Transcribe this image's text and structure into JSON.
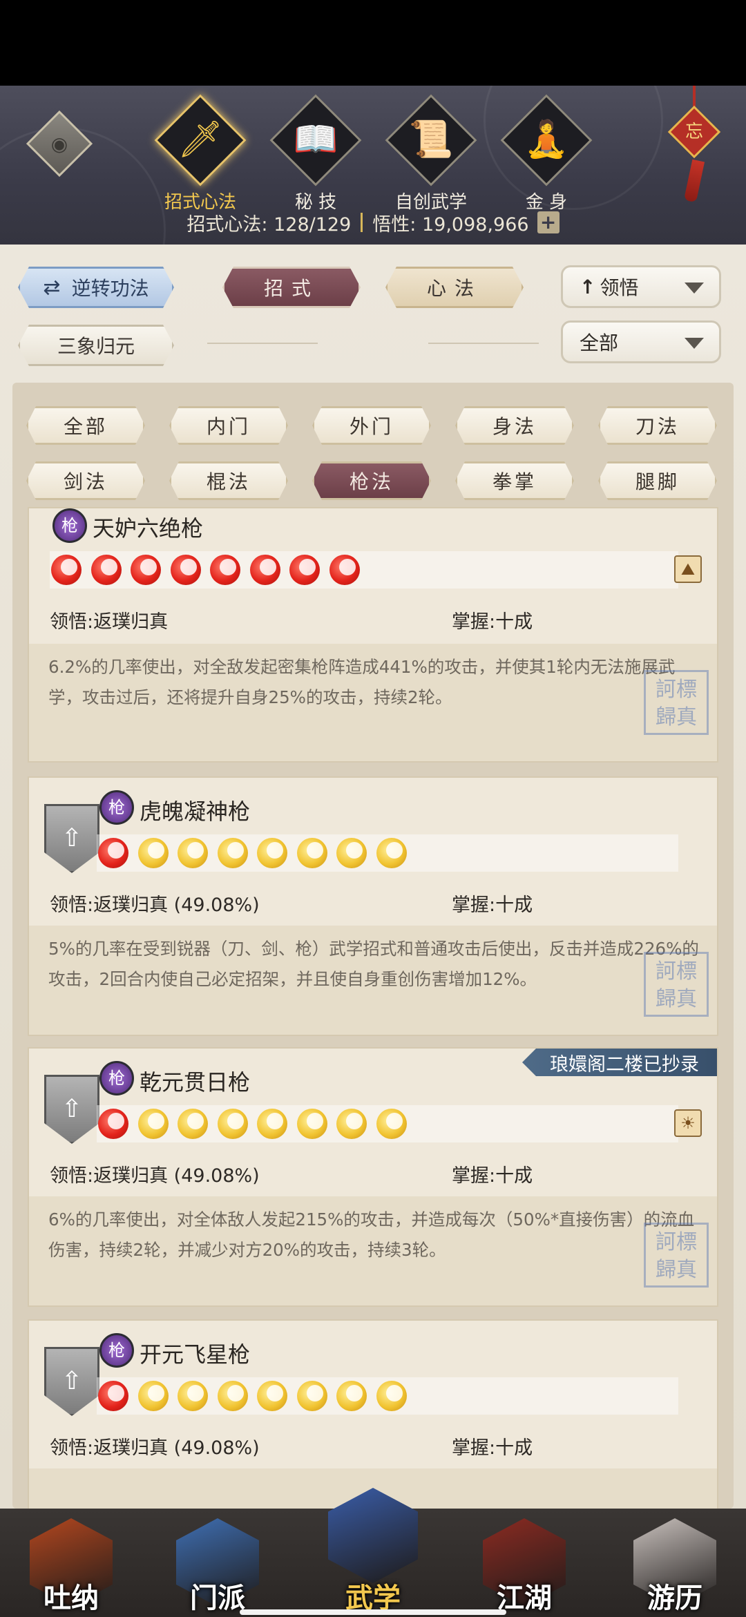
{
  "header": {
    "tabs": [
      {
        "label": "招式心法",
        "icon": "sword-icon",
        "active": true
      },
      {
        "label": "秘 技",
        "icon": "book-icon",
        "active": false
      },
      {
        "label": "自创武学",
        "icon": "scroll-icon",
        "active": false
      },
      {
        "label": "金 身",
        "icon": "meditation-icon",
        "active": false
      }
    ],
    "knot_char": "忘",
    "stats": {
      "moves": "招式心法: 128/129",
      "insight": "悟性: 19,098,966",
      "plus": "+"
    }
  },
  "controls": {
    "reverse": "逆转功法",
    "moves": "招式",
    "mind": "心法",
    "sort": "领悟",
    "sanxiang": "三象归元",
    "filter_all": "全部"
  },
  "filters": [
    "全部",
    "内门",
    "外门",
    "身法",
    "刀法",
    "剑法",
    "棍法",
    "枪法",
    "拳掌",
    "腿脚"
  ],
  "active_filter": "枪法",
  "cards": [
    {
      "name": "天妒六绝枪",
      "red_orbs": 8,
      "gold_orbs": 0,
      "insight_label": "领悟:返璞归真",
      "mastery_label": "掌握:十成",
      "description": "6.2%的几率使出，对全敌发起密集枪阵造成441%的攻击，并使其1轮内无法施展武学，攻击过后，还将提升自身25%的攻击，持续2轮。",
      "upgrade_badge": false,
      "ribbon": ""
    },
    {
      "name": "虎魄凝神枪",
      "red_orbs": 1,
      "gold_orbs": 7,
      "insight_label": "领悟:返璞归真 (49.08%)",
      "mastery_label": "掌握:十成",
      "description": "5%的几率在受到锐器（刀、剑、枪）武学招式和普通攻击后使出，反击并造成226%的攻击，2回合内使自己必定招架，并且使自身重创伤害增加12%。",
      "upgrade_badge": true,
      "ribbon": ""
    },
    {
      "name": "乾元贯日枪",
      "red_orbs": 1,
      "gold_orbs": 7,
      "insight_label": "领悟:返璞归真 (49.08%)",
      "mastery_label": "掌握:十成",
      "description": "6%的几率使出，对全体敌人发起215%的攻击，并造成每次（50%*直接伤害）的流血伤害，持续2轮，并减少对方20%的攻击，持续3轮。",
      "upgrade_badge": true,
      "ribbon": "琅嬛阁二楼已抄录"
    },
    {
      "name": "开元飞星枪",
      "red_orbs": 1,
      "gold_orbs": 7,
      "insight_label": "领悟:返璞归真 (49.08%)",
      "mastery_label": "掌握:十成",
      "description": "",
      "upgrade_badge": true,
      "ribbon": ""
    }
  ],
  "nav": [
    {
      "label": "吐纳",
      "active": false,
      "color": "#b3471f"
    },
    {
      "label": "门派",
      "active": false,
      "color": "#3f6fb3"
    },
    {
      "label": "武学",
      "active": true,
      "color": "#3a5da8"
    },
    {
      "label": "江湖",
      "active": false,
      "color": "#8c2b22"
    },
    {
      "label": "游历",
      "active": false,
      "color": "#c9c1bd"
    }
  ],
  "spear_glyph": "枪",
  "stamp_text": "訶標歸真"
}
